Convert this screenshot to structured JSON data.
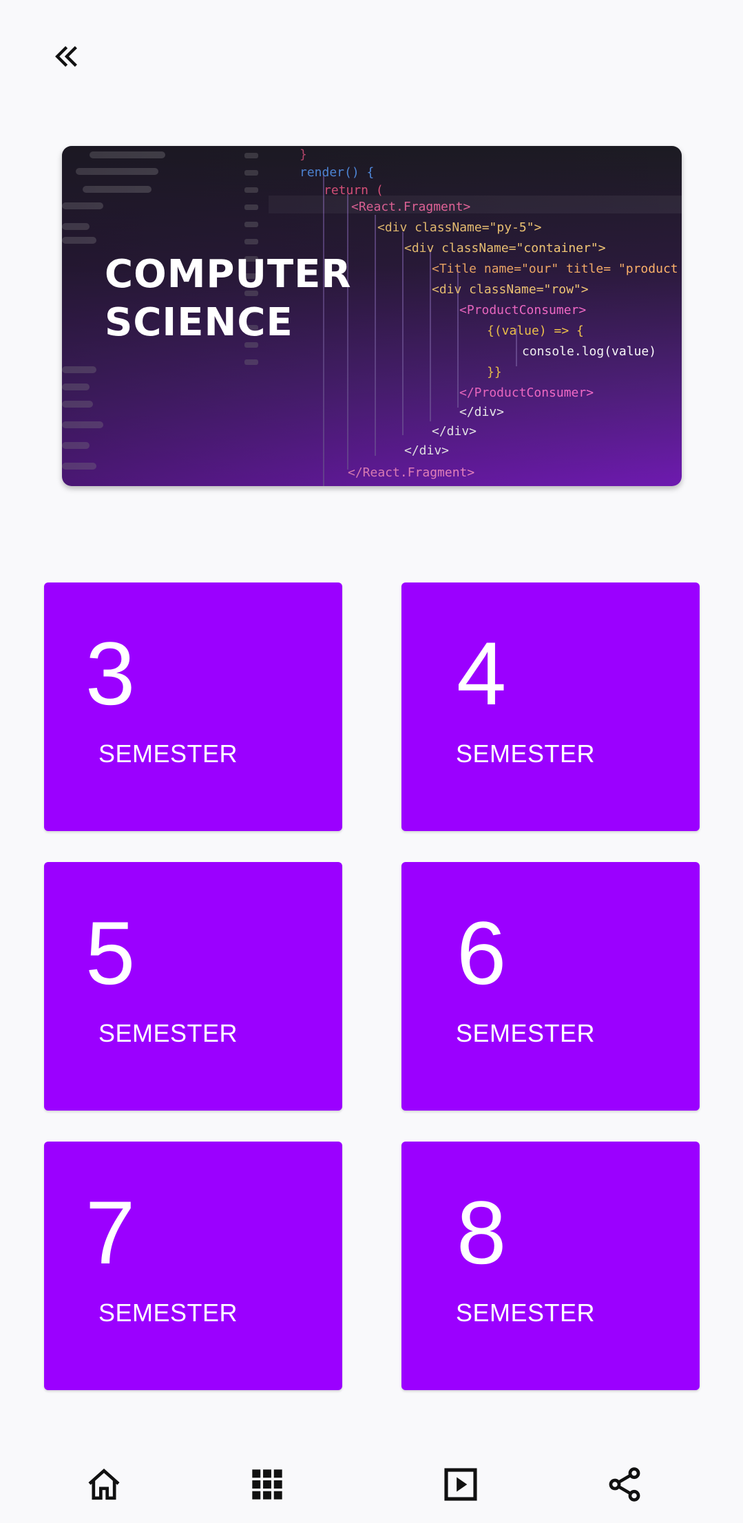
{
  "header": {
    "back_icon": "double-chevron-left-icon"
  },
  "banner": {
    "title_line1": "COMPUTER",
    "title_line2": "SCIENCE",
    "code_lines": [
      "}",
      "render() {",
      "return (",
      "<React.Fragment>",
      "<div className=\"py-5\">",
      "<div className=\"container\">",
      "<Title name=\"our\" title= \"product",
      "<div className=\"row\">",
      "<ProductConsumer>",
      "{(value) => {",
      "console.log(value)",
      "}}",
      "</ProductConsumer>",
      "</div>",
      "</div>",
      "</div>",
      "</React.Fragment>"
    ]
  },
  "semesters": [
    {
      "number": "3",
      "label": "SEMESTER"
    },
    {
      "number": "4",
      "label": "SEMESTER"
    },
    {
      "number": "5",
      "label": "SEMESTER"
    },
    {
      "number": "6",
      "label": "SEMESTER"
    },
    {
      "number": "7",
      "label": "SEMESTER"
    },
    {
      "number": "8",
      "label": "SEMESTER"
    }
  ],
  "bottom_nav": [
    {
      "icon": "home-icon"
    },
    {
      "icon": "grid-icon"
    },
    {
      "icon": "play-icon"
    },
    {
      "icon": "share-icon"
    }
  ],
  "colors": {
    "card": "#9b00ff",
    "background": "#f9f9fb",
    "icon": "#111111"
  }
}
